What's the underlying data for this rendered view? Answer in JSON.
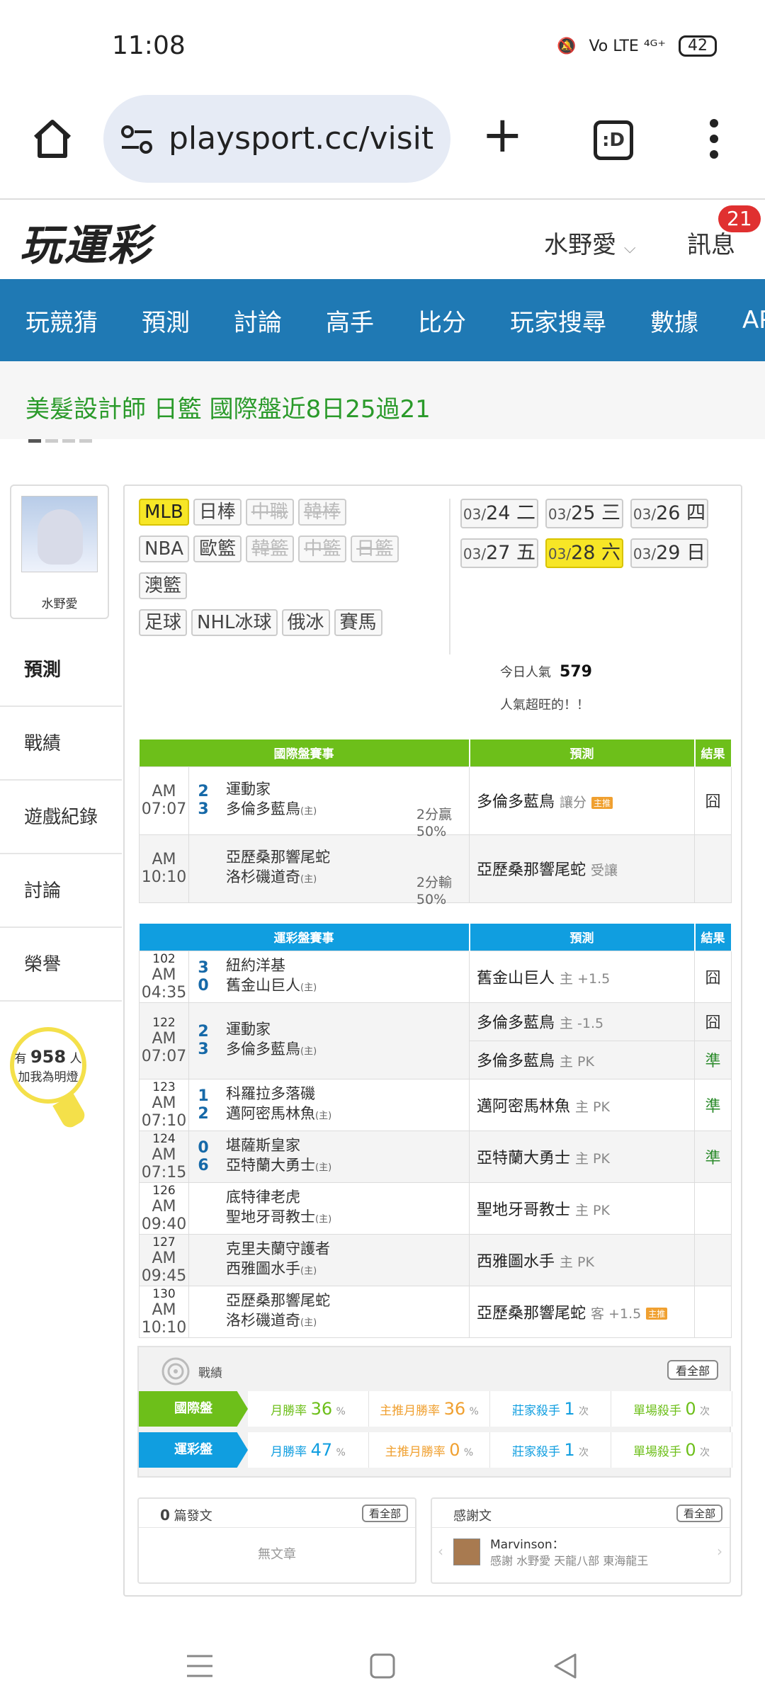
{
  "status": {
    "time": "11:08",
    "signal": "Vo LTE ⁴ᴳ⁺",
    "battery": "42"
  },
  "browser": {
    "url": "playsport.cc/visit"
  },
  "header": {
    "logo": "玩運彩",
    "user": "水野愛",
    "messages": "訊息",
    "badge": "21"
  },
  "nav": [
    "玩競猜",
    "預測",
    "討論",
    "高手",
    "比分",
    "玩家搜尋",
    "數據",
    "APP"
  ],
  "promo": "美髮設計師 日籃 國際盤近8日25過21",
  "sidebar": {
    "name": "水野愛",
    "menu": [
      "預測",
      "戰績",
      "遊戲紀錄",
      "討論",
      "榮譽"
    ],
    "fans_pre": "有",
    "fans": "958",
    "fans_post": "人",
    "fans_sub": "加我為明燈"
  },
  "categories": [
    [
      {
        "t": "MLB",
        "s": "on"
      },
      {
        "t": "日棒",
        "s": ""
      },
      {
        "t": "中職",
        "s": "off"
      },
      {
        "t": "韓棒",
        "s": "off"
      }
    ],
    [
      {
        "t": "NBA",
        "s": ""
      },
      {
        "t": "歐籃",
        "s": ""
      },
      {
        "t": "韓籃",
        "s": "off"
      },
      {
        "t": "中籃",
        "s": "off"
      },
      {
        "t": "日籃",
        "s": "off"
      }
    ],
    [
      {
        "t": "澳籃",
        "s": ""
      }
    ],
    [
      {
        "t": "足球",
        "s": ""
      },
      {
        "t": "NHL冰球",
        "s": ""
      },
      {
        "t": "俄冰",
        "s": ""
      },
      {
        "t": "賽馬",
        "s": ""
      }
    ]
  ],
  "dates": [
    {
      "m": "03/",
      "d": "24 二",
      "on": false
    },
    {
      "m": "03/",
      "d": "25 三",
      "on": false
    },
    {
      "m": "03/",
      "d": "26 四",
      "on": false
    },
    {
      "m": "03/",
      "d": "27 五",
      "on": false
    },
    {
      "m": "03/",
      "d": "28 六",
      "on": true
    },
    {
      "m": "03/",
      "d": "29 日",
      "on": false
    }
  ],
  "popularity": {
    "label": "今日人氣",
    "value": "579",
    "sub": "人氣超旺的！！"
  },
  "intl": {
    "headers": [
      "國際盤賽事",
      "預測",
      "結果"
    ],
    "rows": [
      {
        "time": "AM 07:07",
        "s1": "2",
        "s2": "3",
        "t1": "運動家",
        "t2": "多倫多藍鳥",
        "h": "(主)",
        "ou1": "2分贏",
        "ou2": "50%",
        "pred": "多倫多藍鳥",
        "ps": "讓分",
        "icon": true,
        "res": "囧",
        "z": false
      },
      {
        "time": "AM 10:10",
        "s1": "",
        "s2": "",
        "t1": "亞歷桑那響尾蛇",
        "t2": "洛杉磯道奇",
        "h": "(主)",
        "ou1": "2分輸",
        "ou2": "50%",
        "pred": "亞歷桑那響尾蛇",
        "ps": "受讓",
        "icon": false,
        "res": "",
        "z": false
      }
    ]
  },
  "tw": {
    "headers": [
      "運彩盤賽事",
      "預測",
      "結果"
    ],
    "rows": [
      {
        "no": "102",
        "time": "AM 04:35",
        "s1": "3",
        "s2": "0",
        "t1": "紐約洋基",
        "t2": "舊金山巨人",
        "h": "(主)",
        "preds": [
          {
            "p": "舊金山巨人",
            "s": "主 +1.5",
            "r": "囧",
            "z": false,
            "icon": false
          }
        ]
      },
      {
        "no": "122",
        "time": "AM 07:07",
        "s1": "2",
        "s2": "3",
        "t1": "運動家",
        "t2": "多倫多藍鳥",
        "h": "(主)",
        "preds": [
          {
            "p": "多倫多藍鳥",
            "s": "主 -1.5",
            "r": "囧",
            "z": false,
            "icon": false
          },
          {
            "p": "多倫多藍鳥",
            "s": "主 PK",
            "r": "準",
            "z": true,
            "icon": false
          }
        ]
      },
      {
        "no": "123",
        "time": "AM 07:10",
        "s1": "1",
        "s2": "2",
        "t1": "科羅拉多落磯",
        "t2": "邁阿密馬林魚",
        "h": "(主)",
        "preds": [
          {
            "p": "邁阿密馬林魚",
            "s": "主 PK",
            "r": "準",
            "z": true,
            "icon": false
          }
        ]
      },
      {
        "no": "124",
        "time": "AM 07:15",
        "s1": "0",
        "s2": "6",
        "t1": "堪薩斯皇家",
        "t2": "亞特蘭大勇士",
        "h": "(主)",
        "preds": [
          {
            "p": "亞特蘭大勇士",
            "s": "主 PK",
            "r": "準",
            "z": true,
            "icon": false
          }
        ]
      },
      {
        "no": "126",
        "time": "AM 09:40",
        "s1": "",
        "s2": "",
        "t1": "底特律老虎",
        "t2": "聖地牙哥教士",
        "h": "(主)",
        "preds": [
          {
            "p": "聖地牙哥教士",
            "s": "主 PK",
            "r": "",
            "z": false,
            "icon": false
          }
        ]
      },
      {
        "no": "127",
        "time": "AM 09:45",
        "s1": "",
        "s2": "",
        "t1": "克里夫蘭守護者",
        "t2": "西雅圖水手",
        "h": "(主)",
        "preds": [
          {
            "p": "西雅圖水手",
            "s": "主 PK",
            "r": "",
            "z": false,
            "icon": false
          }
        ]
      },
      {
        "no": "130",
        "time": "AM 10:10",
        "s1": "",
        "s2": "",
        "t1": "亞歷桑那響尾蛇",
        "t2": "洛杉磯道奇",
        "h": "(主)",
        "preds": [
          {
            "p": "亞歷桑那響尾蛇",
            "s": "客 +1.5",
            "r": "",
            "z": false,
            "icon": true
          }
        ]
      }
    ]
  },
  "record": {
    "title": "戰績",
    "all": "看全部",
    "rows": [
      {
        "label": "國際盤",
        "cls": "gr",
        "c1": "月勝率",
        "v1": "36",
        "c2": "主推月勝率",
        "v2": "36",
        "c3": "莊家殺手",
        "v3": "1",
        "c4": "單場殺手",
        "v4": "0"
      },
      {
        "label": "運彩盤",
        "cls": "bl",
        "c1": "月勝率",
        "v1": "47",
        "c2": "主推月勝率",
        "v2": "0",
        "c3": "莊家殺手",
        "v3": "1",
        "c4": "單場殺手",
        "v4": "0"
      }
    ]
  },
  "posts": {
    "count": "0",
    "label": "篇發文",
    "all": "看全部",
    "empty": "無文章"
  },
  "thanks": {
    "title": "感謝文",
    "all": "看全部",
    "user": "Marvinson：",
    "text": "感謝 水野愛 天龍八部 東海龍王"
  },
  "units": {
    "percent": "%",
    "times": "次"
  },
  "icon_label": "主推"
}
